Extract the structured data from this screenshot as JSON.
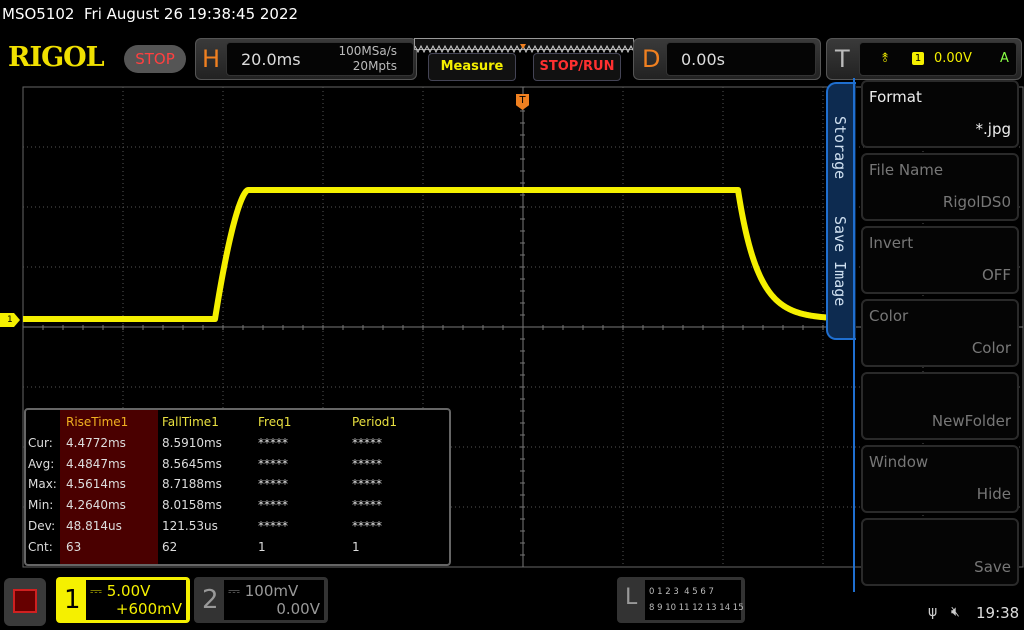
{
  "status_bar": {
    "model": "MSO5102",
    "datetime": "Fri August 26 19:38:45 2022"
  },
  "header": {
    "logo": "RIGOL",
    "run_state": "STOP",
    "horizontal": {
      "label": "H",
      "timebase": "20.0ms",
      "sample_rate": "100MSa/s",
      "memory_depth": "20Mpts"
    },
    "measure_label": "Measure",
    "stop_run_label": "STOP/RUN",
    "delay": {
      "label": "D",
      "value": "0.00s"
    },
    "trigger": {
      "label": "T",
      "slope": "rising-edge-icon",
      "source": "1",
      "level": "0.00V",
      "mode": "A"
    }
  },
  "colors": {
    "ch1": "#f5f000",
    "trigger": "#f08020",
    "menu_accent": "#1f6fd0",
    "stop": "#ff4040"
  },
  "channel1_marker": "1",
  "measurements": {
    "row_labels": [
      "Cur:",
      "Avg:",
      "Max:",
      "Min:",
      "Dev:",
      "Cnt:"
    ],
    "columns": [
      {
        "name": "RiseTime1",
        "values": [
          "4.4772ms",
          "4.4847ms",
          "4.5614ms",
          "4.2640ms",
          "48.814us",
          "63"
        ]
      },
      {
        "name": "FallTime1",
        "values": [
          "8.5910ms",
          "8.5645ms",
          "8.7188ms",
          "8.0158ms",
          "121.53us",
          "62"
        ]
      },
      {
        "name": "Freq1",
        "values": [
          "*****",
          "*****",
          "*****",
          "*****",
          "*****",
          "1"
        ]
      },
      {
        "name": "Period1",
        "values": [
          "*****",
          "*****",
          "*****",
          "*****",
          "*****",
          "1"
        ]
      }
    ]
  },
  "side_menu": {
    "tabs": [
      "Storage",
      "Save Image"
    ],
    "items": [
      {
        "label": "Format",
        "value": "*.jpg",
        "enabled": true
      },
      {
        "label": "File Name",
        "value": "RigolDS0",
        "enabled": false
      },
      {
        "label": "Invert",
        "value": "OFF",
        "enabled": false
      },
      {
        "label": "Color",
        "value": "Color",
        "enabled": false
      },
      {
        "label": "",
        "value": "NewFolder",
        "enabled": false
      },
      {
        "label": "Window",
        "value": "Hide",
        "enabled": false
      },
      {
        "label": "",
        "value": "Save",
        "enabled": false
      }
    ]
  },
  "footer": {
    "ch1": {
      "num": "1",
      "scale": "5.00V",
      "offset": "+600mV"
    },
    "ch2": {
      "num": "2",
      "scale": "100mV",
      "offset": "0.00V"
    },
    "logic": {
      "label": "L",
      "row1": "0 1 2 3  4 5 6 7",
      "row2": "8 9 10 11 12 13 14 15"
    },
    "time": "19:38"
  }
}
